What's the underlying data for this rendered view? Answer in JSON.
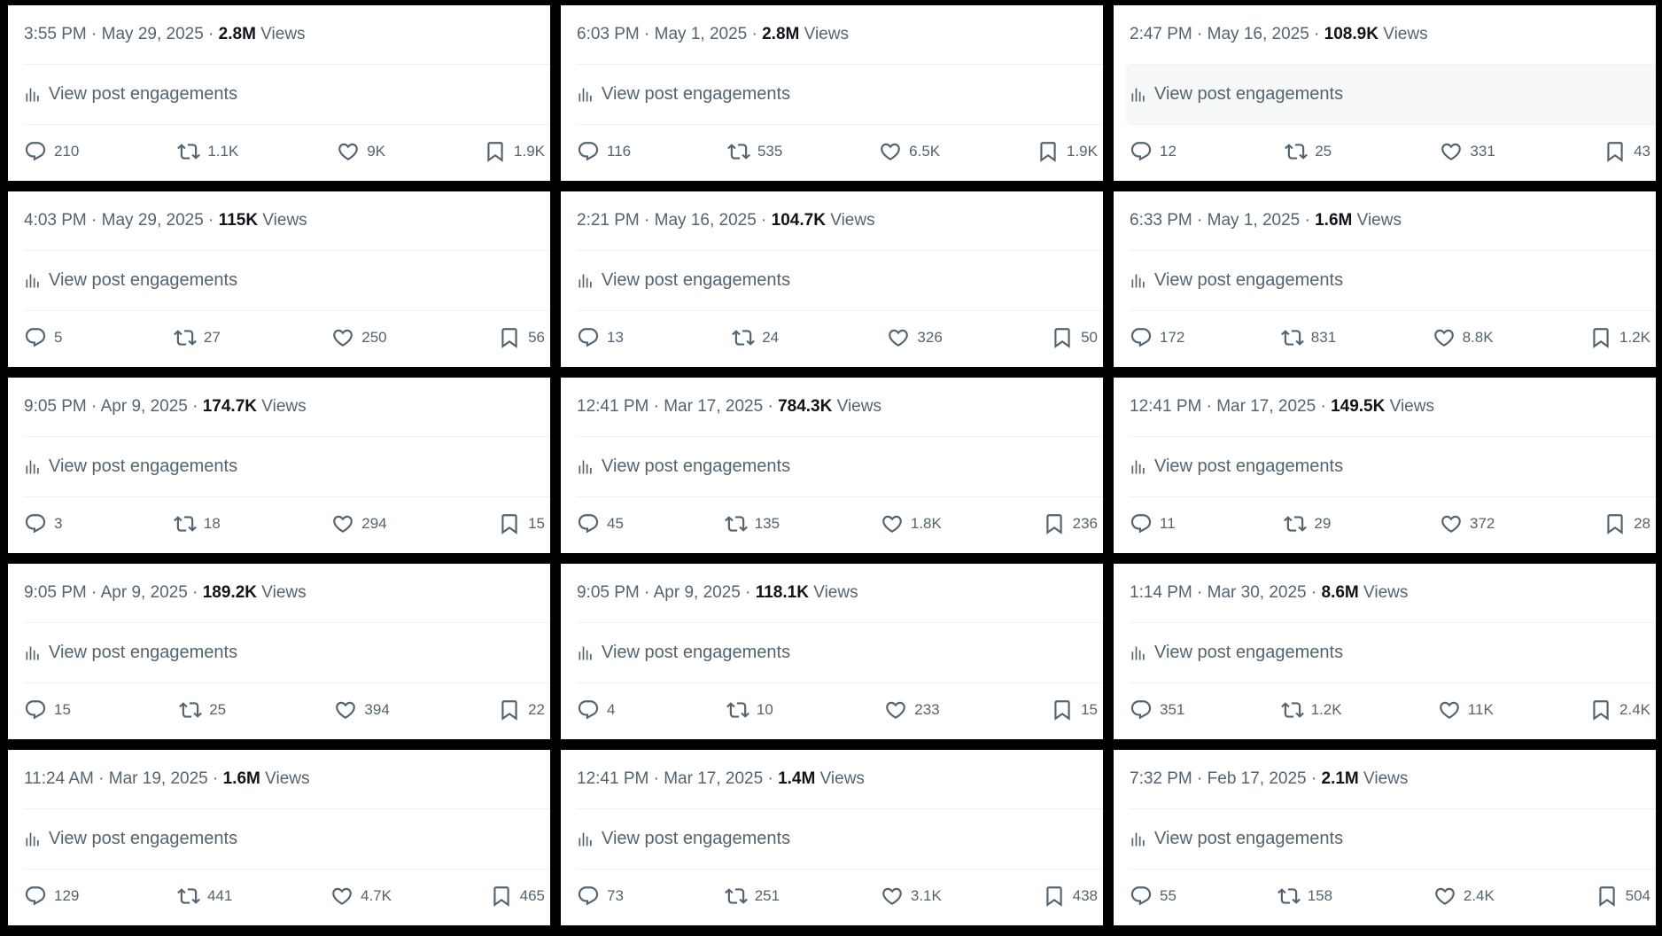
{
  "view_engagements_label": "View post engagements",
  "views_label": "Views",
  "icons": {
    "engagements": "bar-chart-icon",
    "reply": "reply-icon",
    "repost": "repost-icon",
    "like": "heart-icon",
    "bookmark": "bookmark-icon"
  },
  "colors": {
    "text_secondary": "#536471",
    "text_primary": "#0f1419",
    "divider": "#eff3f4",
    "hover_bg": "#f7f9f9",
    "frame": "#000000"
  },
  "posts": [
    {
      "timestamp": "3:55 PM · May 29, 2025 · ",
      "views": "2.8M",
      "replies": "210",
      "reposts": "1.1K",
      "likes": "9K",
      "bookmarks": "1.9K"
    },
    {
      "timestamp": "6:03 PM · May 1, 2025 · ",
      "views": "2.8M",
      "replies": "116",
      "reposts": "535",
      "likes": "6.5K",
      "bookmarks": "1.9K"
    },
    {
      "timestamp": "2:47 PM · May 16, 2025 · ",
      "views": "108.9K",
      "replies": "12",
      "reposts": "25",
      "likes": "331",
      "bookmarks": "43",
      "hovered": true
    },
    {
      "timestamp": "4:03 PM · May 29, 2025 · ",
      "views": "115K",
      "replies": "5",
      "reposts": "27",
      "likes": "250",
      "bookmarks": "56"
    },
    {
      "timestamp": "2:21 PM · May 16, 2025 · ",
      "views": "104.7K",
      "replies": "13",
      "reposts": "24",
      "likes": "326",
      "bookmarks": "50"
    },
    {
      "timestamp": "6:33 PM · May 1, 2025 · ",
      "views": "1.6M",
      "replies": "172",
      "reposts": "831",
      "likes": "8.8K",
      "bookmarks": "1.2K"
    },
    {
      "timestamp": "9:05 PM · Apr 9, 2025 · ",
      "views": "174.7K",
      "replies": "3",
      "reposts": "18",
      "likes": "294",
      "bookmarks": "15"
    },
    {
      "timestamp": "12:41 PM · Mar 17, 2025 · ",
      "views": "784.3K",
      "replies": "45",
      "reposts": "135",
      "likes": "1.8K",
      "bookmarks": "236"
    },
    {
      "timestamp": "12:41 PM · Mar 17, 2025 · ",
      "views": "149.5K",
      "replies": "11",
      "reposts": "29",
      "likes": "372",
      "bookmarks": "28"
    },
    {
      "timestamp": "9:05 PM · Apr 9, 2025 · ",
      "views": "189.2K",
      "replies": "15",
      "reposts": "25",
      "likes": "394",
      "bookmarks": "22"
    },
    {
      "timestamp": "9:05 PM · Apr 9, 2025 · ",
      "views": "118.1K",
      "replies": "4",
      "reposts": "10",
      "likes": "233",
      "bookmarks": "15"
    },
    {
      "timestamp": "1:14 PM · Mar 30, 2025 · ",
      "views": "8.6M",
      "replies": "351",
      "reposts": "1.2K",
      "likes": "11K",
      "bookmarks": "2.4K"
    },
    {
      "timestamp": "11:24 AM · Mar 19, 2025 · ",
      "views": "1.6M",
      "replies": "129",
      "reposts": "441",
      "likes": "4.7K",
      "bookmarks": "465"
    },
    {
      "timestamp": "12:41 PM · Mar 17, 2025 · ",
      "views": "1.4M",
      "replies": "73",
      "reposts": "251",
      "likes": "3.1K",
      "bookmarks": "438"
    },
    {
      "timestamp": "7:32 PM · Feb 17, 2025 · ",
      "views": "2.1M",
      "replies": "55",
      "reposts": "158",
      "likes": "2.4K",
      "bookmarks": "504"
    }
  ]
}
